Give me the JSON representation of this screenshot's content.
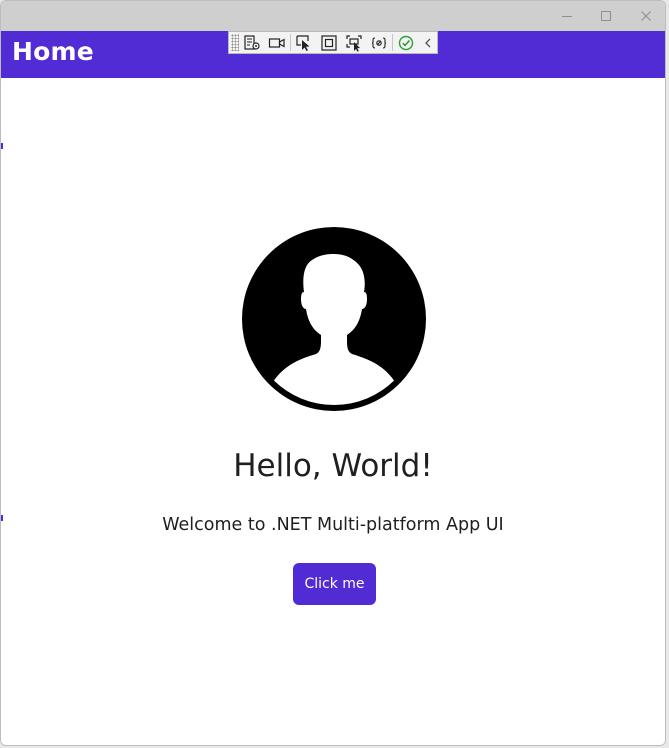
{
  "window": {
    "caption_buttons": {
      "minimize_icon": "minimize-icon",
      "maximize_icon": "maximize-icon",
      "close_icon": "close-icon"
    }
  },
  "navbar": {
    "title": "Home",
    "background": "#512bd4"
  },
  "debug_toolbar": {
    "tools": [
      {
        "name": "go-to-live-visual-tree-icon"
      },
      {
        "name": "record-icon"
      },
      {
        "name": "select-element-icon"
      },
      {
        "name": "display-layout-adorners-icon"
      },
      {
        "name": "track-focused-element-icon"
      },
      {
        "name": "binding-failures-icon"
      },
      {
        "name": "accessibility-check-icon"
      },
      {
        "name": "collapse-toolbar-icon"
      }
    ]
  },
  "main": {
    "avatar_icon": "user-avatar-icon",
    "heading": "Hello, World!",
    "subheading": "Welcome to .NET Multi-platform App UI",
    "button_label": "Click me",
    "accent_color": "#512bd4"
  }
}
